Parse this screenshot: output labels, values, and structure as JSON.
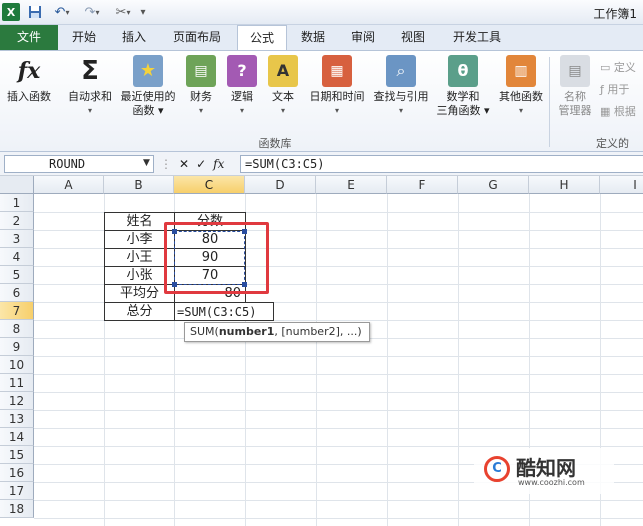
{
  "window": {
    "title": "工作簿1"
  },
  "quick_access": {
    "app_icon": "X",
    "save_icon": "save-icon",
    "undo_icon": "undo-icon",
    "redo_icon": "redo-icon",
    "tool_icon": "tools-icon"
  },
  "tabs": [
    {
      "label": "文件"
    },
    {
      "label": "开始"
    },
    {
      "label": "插入"
    },
    {
      "label": "页面布局"
    },
    {
      "label": "公式"
    },
    {
      "label": "数据"
    },
    {
      "label": "审阅"
    },
    {
      "label": "视图"
    },
    {
      "label": "开发工具"
    }
  ],
  "ribbon": {
    "group_label": "函数库",
    "group2_label": "定义的",
    "buttons": [
      {
        "line1": "插入函数",
        "line2": ""
      },
      {
        "line1": "自动求和",
        "line2": "▾"
      },
      {
        "line1": "最近使用的",
        "line2": "函数 ▾"
      },
      {
        "line1": "财务",
        "line2": "▾"
      },
      {
        "line1": "逻辑",
        "line2": "▾"
      },
      {
        "line1": "文本",
        "line2": "▾"
      },
      {
        "line1": "日期和时间",
        "line2": "▾"
      },
      {
        "line1": "查找与引用",
        "line2": "▾"
      },
      {
        "line1": "数学和",
        "line2": "三角函数 ▾"
      },
      {
        "line1": "其他函数",
        "line2": "▾"
      }
    ],
    "name_manager": {
      "line1": "名称",
      "line2": "管理器"
    },
    "side": [
      {
        "label": "定义"
      },
      {
        "label": "用于"
      },
      {
        "label": "根据"
      }
    ]
  },
  "formula_bar": {
    "name_box": "ROUND",
    "cancel": "✕",
    "enter": "✓",
    "fx": "fx",
    "formula": "=SUM(C3:C5)"
  },
  "columns": [
    "A",
    "B",
    "C",
    "D",
    "E",
    "F",
    "G",
    "H",
    "I"
  ],
  "rows": [
    "1",
    "2",
    "3",
    "4",
    "5",
    "6",
    "7",
    "8",
    "9",
    "10",
    "11",
    "12",
    "13",
    "14",
    "15",
    "16",
    "17",
    "18"
  ],
  "cells": {
    "B2": "姓名",
    "C2": "分数",
    "B3": "小李",
    "C3": "80",
    "B4": "小王",
    "C4": "90",
    "B5": "小张",
    "C5": "70",
    "B6": "平均分",
    "C6": "80",
    "B7": "总分",
    "C7": "=SUM(C3:C5)"
  },
  "tooltip": {
    "fn": "SUM(",
    "arg1": "number1",
    "rest": ", [number2], ...)"
  },
  "watermark": {
    "logo": "C",
    "name": "酷知网",
    "url": "www.coozhi.com"
  }
}
